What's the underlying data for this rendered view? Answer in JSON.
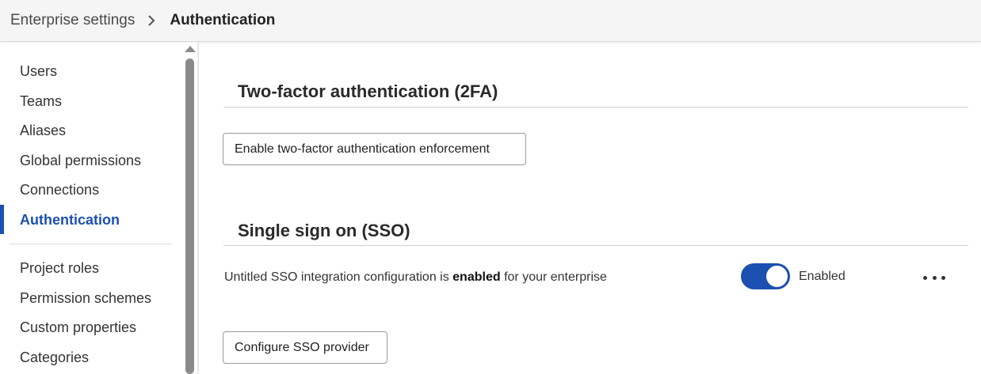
{
  "breadcrumb": {
    "parent": "Enterprise settings",
    "current": "Authentication",
    "separator_icon": "chevron-right-icon"
  },
  "sidebar": {
    "items": [
      {
        "label": "Users",
        "active": false
      },
      {
        "label": "Teams",
        "active": false
      },
      {
        "label": "Aliases",
        "active": false
      },
      {
        "label": "Global permissions",
        "active": false
      },
      {
        "label": "Connections",
        "active": false
      },
      {
        "label": "Authentication",
        "active": true
      },
      {
        "label": "Project roles",
        "active": false
      },
      {
        "label": "Permission schemes",
        "active": false
      },
      {
        "label": "Custom properties",
        "active": false
      },
      {
        "label": "Categories",
        "active": false
      }
    ]
  },
  "two_factor": {
    "title": "Two-factor authentication (2FA)",
    "button_label": "Enable two-factor authentication enforcement"
  },
  "sso": {
    "title": "Single sign on (SSO)",
    "status_prefix": "Untitled SSO integration configuration is ",
    "status_emphasis": "enabled",
    "status_suffix": " for your enterprise",
    "toggle_on": true,
    "toggle_label": "Enabled",
    "more_icon": "more-horizontal-icon",
    "configure_button_label": "Configure SSO provider"
  },
  "colors": {
    "accent": "#1b4fb0",
    "topbar_bg": "#f5f5f5"
  }
}
